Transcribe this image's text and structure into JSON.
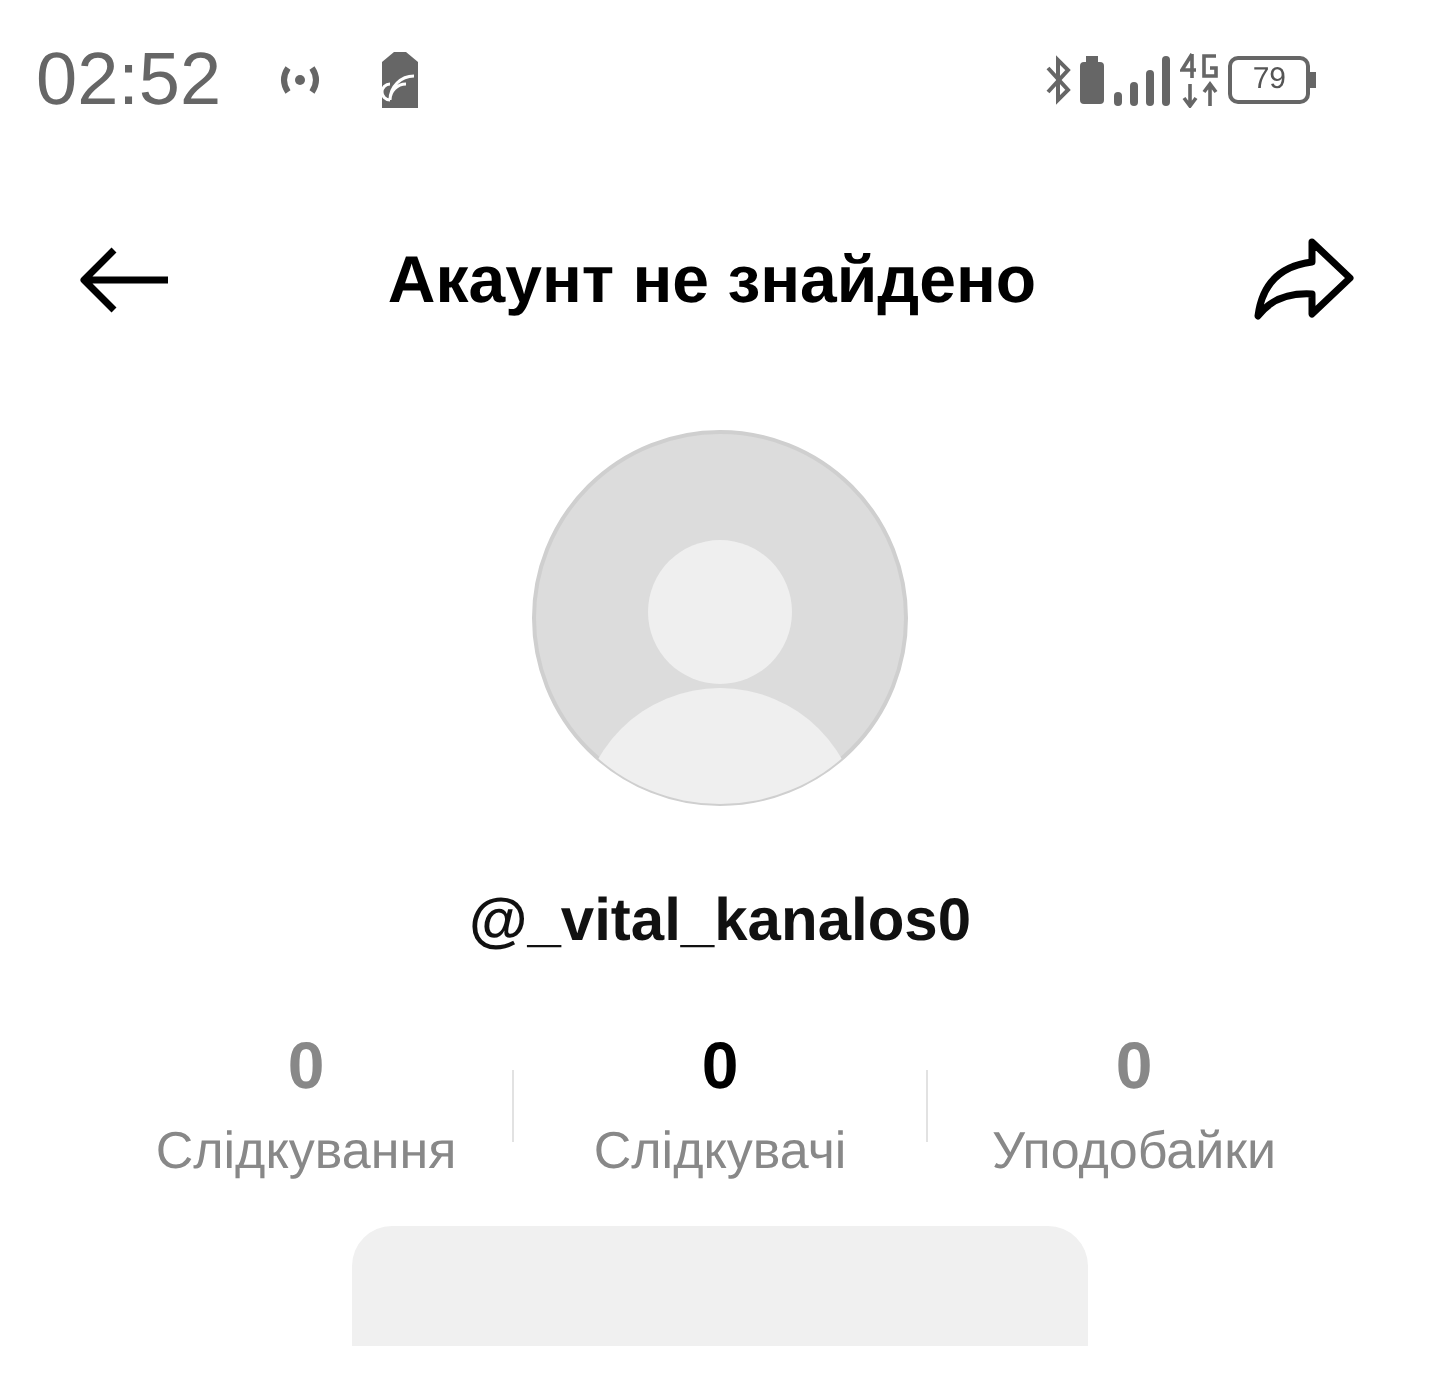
{
  "status_bar": {
    "time": "02:52",
    "battery": "79"
  },
  "header": {
    "title": "Акаунт не знайдено"
  },
  "profile": {
    "username": "@_vital_kanalos0"
  },
  "stats": [
    {
      "value": "0",
      "label": "Слідкування",
      "selected": false
    },
    {
      "value": "0",
      "label": "Слідкувачі",
      "selected": true
    },
    {
      "value": "0",
      "label": "Уподобайки",
      "selected": false
    }
  ],
  "panel": {
    "kind": "placeholder"
  }
}
